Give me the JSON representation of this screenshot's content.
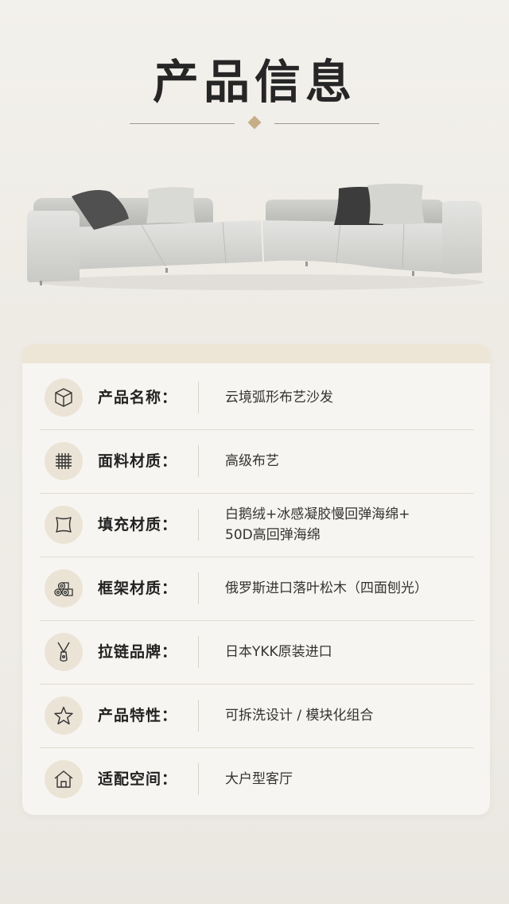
{
  "title": "产品信息",
  "rows": [
    {
      "label": "产品名称：",
      "value_lines": [
        "云境弧形布艺沙发"
      ],
      "icon": "box-icon"
    },
    {
      "label": "面料材质：",
      "value_lines": [
        "高级布艺"
      ],
      "icon": "fabric-grid-icon"
    },
    {
      "label": "填充材质：",
      "value_lines": [
        "白鹅绒+冰感凝胶慢回弹海绵+",
        "50D高回弹海绵"
      ],
      "icon": "cushion-icon"
    },
    {
      "label": "框架材质：",
      "value_lines": [
        "俄罗斯进口落叶松木（四面刨光）"
      ],
      "icon": "wood-logs-icon"
    },
    {
      "label": "拉链品牌：",
      "value_lines": [
        "日本YKK原装进口"
      ],
      "icon": "zipper-icon"
    },
    {
      "label": "产品特性：",
      "value_lines": [
        "可拆洗设计 / 模块化组合"
      ],
      "icon": "star-icon"
    },
    {
      "label": "适配空间：",
      "value_lines": [
        "大户型客厅"
      ],
      "icon": "house-icon"
    }
  ],
  "colors": {
    "accent": "#c7ae88",
    "card_bg": "#f7f5f1",
    "icon_bg": "#ebe3d6"
  }
}
